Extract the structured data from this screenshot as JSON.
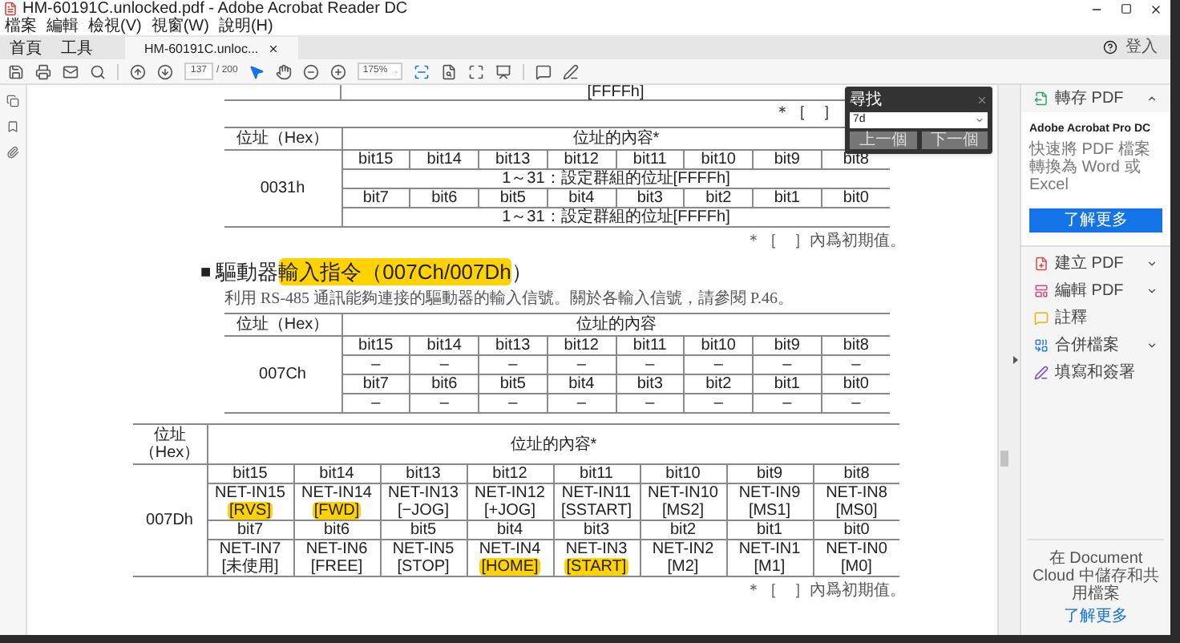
{
  "window": {
    "title": "HM-60191C.unlocked.pdf - Adobe Acrobat Reader DC"
  },
  "menu": [
    "檔案",
    "編輯",
    "檢視(V)",
    "視窗(W)",
    "說明(H)"
  ],
  "tabs": [
    {
      "label": "首頁",
      "kind": "nav",
      "selected": false
    },
    {
      "label": "工具",
      "kind": "nav",
      "selected": false
    },
    {
      "label": "HM-60191C.unloc...",
      "kind": "document",
      "selected": true
    }
  ],
  "account": {
    "signin": "登入"
  },
  "toolbar": {
    "page": "137",
    "page_total": "/ 200",
    "zoom": "175%"
  },
  "find": {
    "title": "尋找",
    "query": "7d",
    "buttons": [
      "上一個",
      "下一個"
    ]
  },
  "document": {
    "top_fragment": "[FFFFh]",
    "top_footnote": "＊［　］",
    "table1": {
      "address": "0031h",
      "header": [
        "位址（Hex）",
        "位址的內容*"
      ],
      "rows": [
        {
          "kind": "bits",
          "cells": [
            "bit15",
            "bit14",
            "bit13",
            "bit12",
            "bit11",
            "bit10",
            "bit9",
            "bit8"
          ]
        },
        {
          "kind": "span",
          "text": "1～31：設定群組的位址[FFFFh]"
        },
        {
          "kind": "bits",
          "cells": [
            "bit7",
            "bit6",
            "bit5",
            "bit4",
            "bit3",
            "bit2",
            "bit1",
            "bit0"
          ]
        },
        {
          "kind": "span",
          "text": "1～31：設定群組的位址[FFFFh]"
        }
      ]
    },
    "footnote1": "＊［　］內爲初期值。",
    "heading": {
      "bullet": "■",
      "segments": [
        {
          "text": "驅動器",
          "highlighted": false
        },
        {
          "text": "輸入指令（007Ch/007Dh",
          "highlighted": true
        },
        {
          "text": "）",
          "highlighted": false
        }
      ]
    },
    "paragraph": "利用 RS-485 通訊能夠連接的驅動器的輸入信號。關於各輸入信號，請參閱 P.46。",
    "table2": {
      "address": "007Ch",
      "header": [
        "位址（Hex）",
        "位址的內容"
      ],
      "rows": [
        {
          "kind": "bits",
          "cells": [
            "bit15",
            "bit14",
            "bit13",
            "bit12",
            "bit11",
            "bit10",
            "bit9",
            "bit8"
          ]
        },
        {
          "kind": "bits",
          "cells": [
            "–",
            "–",
            "–",
            "–",
            "–",
            "–",
            "–",
            "–"
          ]
        },
        {
          "kind": "bits",
          "cells": [
            "bit7",
            "bit6",
            "bit5",
            "bit4",
            "bit3",
            "bit2",
            "bit1",
            "bit0"
          ]
        },
        {
          "kind": "bits",
          "cells": [
            "–",
            "–",
            "–",
            "–",
            "–",
            "–",
            "–",
            "–"
          ]
        }
      ]
    },
    "table3": {
      "address": "007Dh",
      "header": [
        "位址（Hex）",
        "位址的內容*"
      ],
      "rows": [
        {
          "kind": "bits",
          "cells": [
            "bit15",
            "bit14",
            "bit13",
            "bit12",
            "bit11",
            "bit10",
            "bit9",
            "bit8"
          ]
        },
        {
          "kind": "signals",
          "cells": [
            {
              "name": "NET-IN15",
              "value": "[RVS]",
              "highlighted": true
            },
            {
              "name": "NET-IN14",
              "value": "[FWD]",
              "highlighted": true
            },
            {
              "name": "NET-IN13",
              "value": "[−JOG]",
              "highlighted": false
            },
            {
              "name": "NET-IN12",
              "value": "[+JOG]",
              "highlighted": false
            },
            {
              "name": "NET-IN11",
              "value": "[SSTART]",
              "highlighted": false
            },
            {
              "name": "NET-IN10",
              "value": "[MS2]",
              "highlighted": false
            },
            {
              "name": "NET-IN9",
              "value": "[MS1]",
              "highlighted": false
            },
            {
              "name": "NET-IN8",
              "value": "[MS0]",
              "highlighted": false
            }
          ]
        },
        {
          "kind": "bits",
          "cells": [
            "bit7",
            "bit6",
            "bit5",
            "bit4",
            "bit3",
            "bit2",
            "bit1",
            "bit0"
          ]
        },
        {
          "kind": "signals",
          "cells": [
            {
              "name": "NET-IN7",
              "value": "[未使用]",
              "highlighted": false
            },
            {
              "name": "NET-IN6",
              "value": "[FREE]",
              "highlighted": false
            },
            {
              "name": "NET-IN5",
              "value": "[STOP]",
              "highlighted": false
            },
            {
              "name": "NET-IN4",
              "value": "[HOME]",
              "highlighted": true
            },
            {
              "name": "NET-IN3",
              "value": "[START]",
              "highlighted": true
            },
            {
              "name": "NET-IN2",
              "value": "[M2]",
              "highlighted": false
            },
            {
              "name": "NET-IN1",
              "value": "[M1]",
              "highlighted": false
            },
            {
              "name": "NET-IN0",
              "value": "[M0]",
              "highlighted": false
            }
          ]
        }
      ]
    },
    "footnote2": "＊［　］內爲初期值。"
  },
  "tools_pane": {
    "items": [
      {
        "label": "轉存 PDF",
        "kind": "expandable",
        "expanded": true
      },
      {
        "label": "建立 PDF",
        "kind": "expandable",
        "expanded": false
      },
      {
        "label": "編輯 PDF",
        "kind": "expandable",
        "expanded": false
      },
      {
        "label": "註釋",
        "kind": "plain"
      },
      {
        "label": "合併檔案",
        "kind": "expandable",
        "expanded": false
      },
      {
        "label": "填寫和簽署",
        "kind": "plain"
      }
    ],
    "promo": {
      "title": "Adobe Acrobat Pro DC",
      "text": "快速將 PDF 檔案轉換為 Word 或 Excel",
      "button": "了解更多"
    },
    "footer": {
      "text": "在 Document Cloud 中儲存和共用檔案",
      "link": "了解更多"
    }
  }
}
